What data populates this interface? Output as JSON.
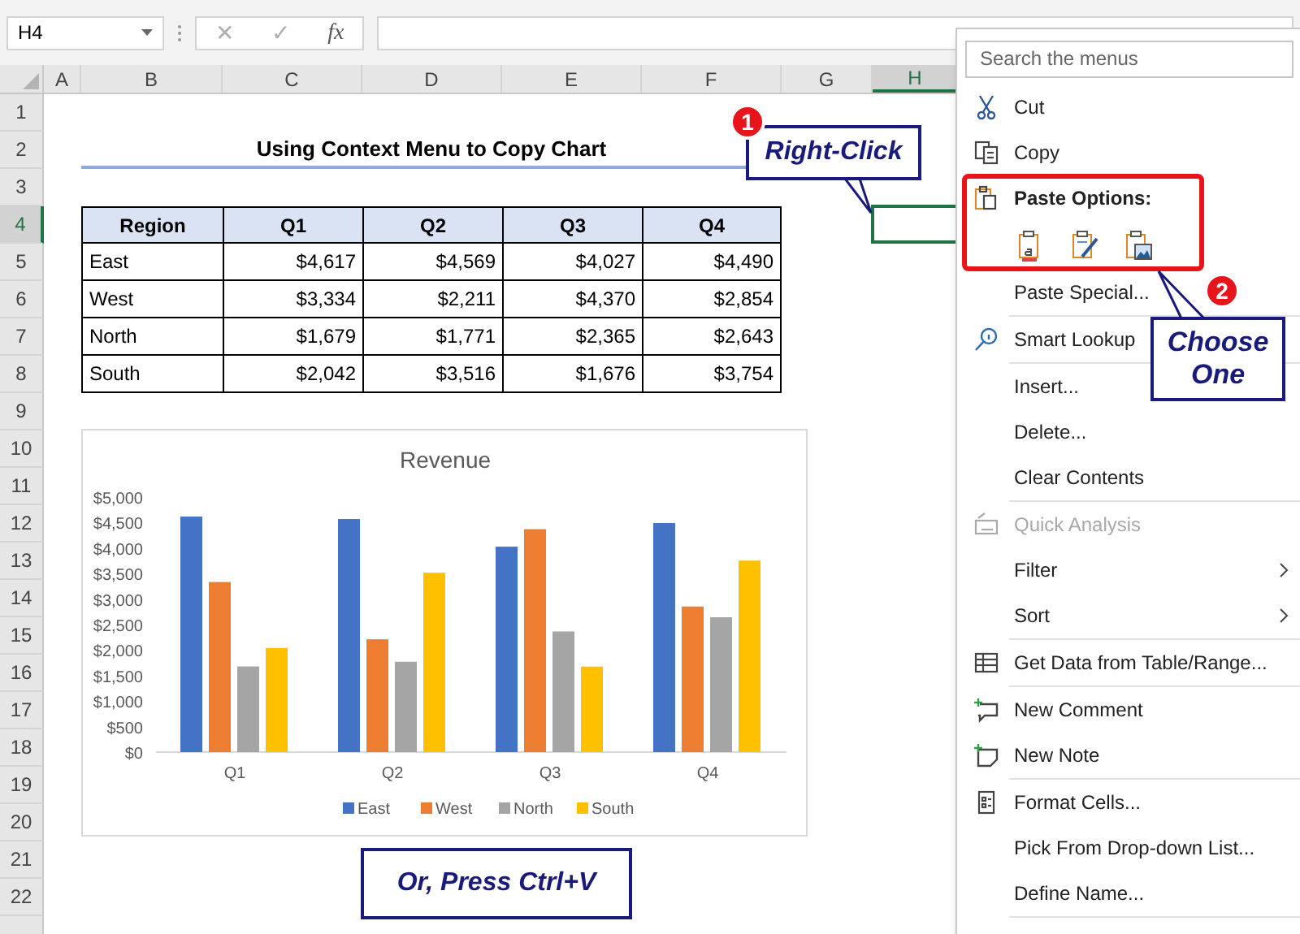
{
  "formula_bar": {
    "name_box": "H4",
    "cancel": "✕",
    "enter": "✓",
    "function": "fx"
  },
  "columns": [
    {
      "label": "A",
      "selected": false
    },
    {
      "label": "B",
      "selected": false
    },
    {
      "label": "C",
      "selected": false
    },
    {
      "label": "D",
      "selected": false
    },
    {
      "label": "E",
      "selected": false
    },
    {
      "label": "F",
      "selected": false
    },
    {
      "label": "G",
      "selected": false
    },
    {
      "label": "H",
      "selected": true
    }
  ],
  "rows": [
    {
      "label": "1",
      "selected": false
    },
    {
      "label": "2",
      "selected": false
    },
    {
      "label": "3",
      "selected": false
    },
    {
      "label": "4",
      "selected": true
    },
    {
      "label": "5",
      "selected": false
    },
    {
      "label": "6",
      "selected": false
    },
    {
      "label": "7",
      "selected": false
    },
    {
      "label": "8",
      "selected": false
    },
    {
      "label": "9",
      "selected": false
    },
    {
      "label": "10",
      "selected": false
    },
    {
      "label": "11",
      "selected": false
    },
    {
      "label": "12",
      "selected": false
    },
    {
      "label": "13",
      "selected": false
    },
    {
      "label": "14",
      "selected": false
    },
    {
      "label": "15",
      "selected": false
    },
    {
      "label": "16",
      "selected": false
    },
    {
      "label": "17",
      "selected": false
    },
    {
      "label": "18",
      "selected": false
    },
    {
      "label": "19",
      "selected": false
    },
    {
      "label": "20",
      "selected": false
    },
    {
      "label": "21",
      "selected": false
    },
    {
      "label": "22",
      "selected": false
    }
  ],
  "sheet_title": "Using Context Menu to Copy Chart",
  "table": {
    "columns": [
      "Region",
      "Q1",
      "Q2",
      "Q3",
      "Q4"
    ],
    "rows": [
      [
        "East",
        "$4,617",
        "$4,569",
        "$4,027",
        "$4,490"
      ],
      [
        "West",
        "$3,334",
        "$2,211",
        "$4,370",
        "$2,854"
      ],
      [
        "North",
        "$1,679",
        "$1,771",
        "$2,365",
        "$2,643"
      ],
      [
        "South",
        "$2,042",
        "$3,516",
        "$1,676",
        "$3,754"
      ]
    ]
  },
  "chart": {
    "chart_data": {
      "type": "bar",
      "title": "Revenue",
      "categories": [
        "Q1",
        "Q2",
        "Q3",
        "Q4"
      ],
      "series": [
        {
          "name": "East",
          "color": "#4472c4",
          "values": [
            4617,
            4569,
            4027,
            4490
          ]
        },
        {
          "name": "West",
          "color": "#ed7d31",
          "values": [
            3334,
            2211,
            4370,
            2854
          ]
        },
        {
          "name": "North",
          "color": "#a5a5a5",
          "values": [
            1679,
            1771,
            2365,
            2643
          ]
        },
        {
          "name": "South",
          "color": "#ffc000",
          "values": [
            2042,
            3516,
            1676,
            3754
          ]
        }
      ],
      "ylim": [
        0,
        5000
      ],
      "legend": "bottom",
      "yticks": [
        {
          "value": 0,
          "label": "$0"
        },
        {
          "value": 500,
          "label": "$500"
        },
        {
          "value": 1000,
          "label": "$1,000"
        },
        {
          "value": 1500,
          "label": "$1,500"
        },
        {
          "value": 2000,
          "label": "$2,000"
        },
        {
          "value": 2500,
          "label": "$2,500"
        },
        {
          "value": 3000,
          "label": "$3,000"
        },
        {
          "value": 3500,
          "label": "$3,500"
        },
        {
          "value": 4000,
          "label": "$4,000"
        },
        {
          "value": 4500,
          "label": "$4,500"
        },
        {
          "value": 5000,
          "label": "$5,000"
        }
      ]
    }
  },
  "callouts": [
    {
      "badge": "1",
      "text": "Right-Click"
    },
    {
      "badge": "2",
      "text": "Choose One"
    },
    {
      "text": "Or, Press Ctrl+V"
    }
  ],
  "context_menu": {
    "search_placeholder": "Search the menus",
    "items": [
      {
        "kind": "command",
        "label": "Cut",
        "disabled": false,
        "submenu": false
      },
      {
        "kind": "command",
        "label": "Copy",
        "disabled": false,
        "submenu": false
      },
      {
        "kind": "paste_options",
        "label": "Paste Options:"
      },
      {
        "kind": "command",
        "label": "Paste Special...",
        "disabled": false,
        "submenu": false
      },
      {
        "kind": "separator"
      },
      {
        "kind": "command",
        "label": "Smart Lookup",
        "disabled": false,
        "submenu": false
      },
      {
        "kind": "separator"
      },
      {
        "kind": "command",
        "label": "Insert...",
        "disabled": false,
        "submenu": false
      },
      {
        "kind": "command",
        "label": "Delete...",
        "disabled": false,
        "submenu": false
      },
      {
        "kind": "command",
        "label": "Clear Contents",
        "disabled": false,
        "submenu": false
      },
      {
        "kind": "separator"
      },
      {
        "kind": "command",
        "label": "Quick Analysis",
        "disabled": true,
        "submenu": false
      },
      {
        "kind": "command",
        "label": "Filter",
        "disabled": false,
        "submenu": true
      },
      {
        "kind": "command",
        "label": "Sort",
        "disabled": false,
        "submenu": true
      },
      {
        "kind": "separator"
      },
      {
        "kind": "command",
        "label": "Get Data from Table/Range...",
        "disabled": false,
        "submenu": false
      },
      {
        "kind": "separator"
      },
      {
        "kind": "command",
        "label": "New Comment",
        "disabled": false,
        "submenu": false
      },
      {
        "kind": "command",
        "label": "New Note",
        "disabled": false,
        "submenu": false
      },
      {
        "kind": "separator"
      },
      {
        "kind": "command",
        "label": "Format Cells...",
        "disabled": false,
        "submenu": false
      },
      {
        "kind": "command",
        "label": "Pick From Drop-down List...",
        "disabled": false,
        "submenu": false
      },
      {
        "kind": "command",
        "label": "Define Name...",
        "disabled": false,
        "submenu": false
      },
      {
        "kind": "separator"
      }
    ]
  }
}
